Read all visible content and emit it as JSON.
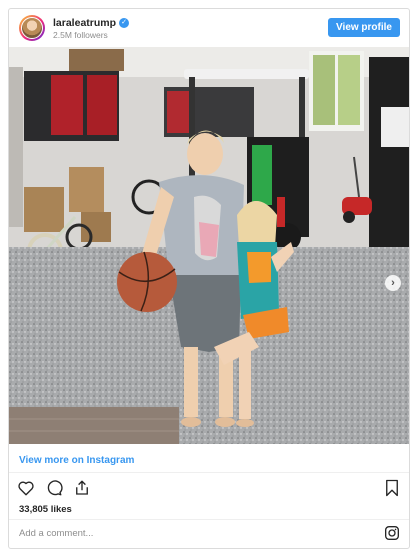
{
  "header": {
    "username": "laraleatrump",
    "verified_mark": "✓",
    "followers": "2.5M followers",
    "view_profile_label": "View profile"
  },
  "photo": {
    "alt_subject": "two-children-in-garage-photo",
    "next_arrow": "›"
  },
  "footer": {
    "view_more_label": "View more on Instagram",
    "likes": "33,805 likes",
    "comment_placeholder": "Add a comment..."
  },
  "icons": {
    "like": "heart-icon",
    "comment": "comment-icon",
    "share": "share-icon",
    "save": "bookmark-icon",
    "brand": "instagram-icon"
  },
  "colors": {
    "accent": "#3897f0",
    "border": "#dbdbdb",
    "muted": "#8e8e8e"
  }
}
